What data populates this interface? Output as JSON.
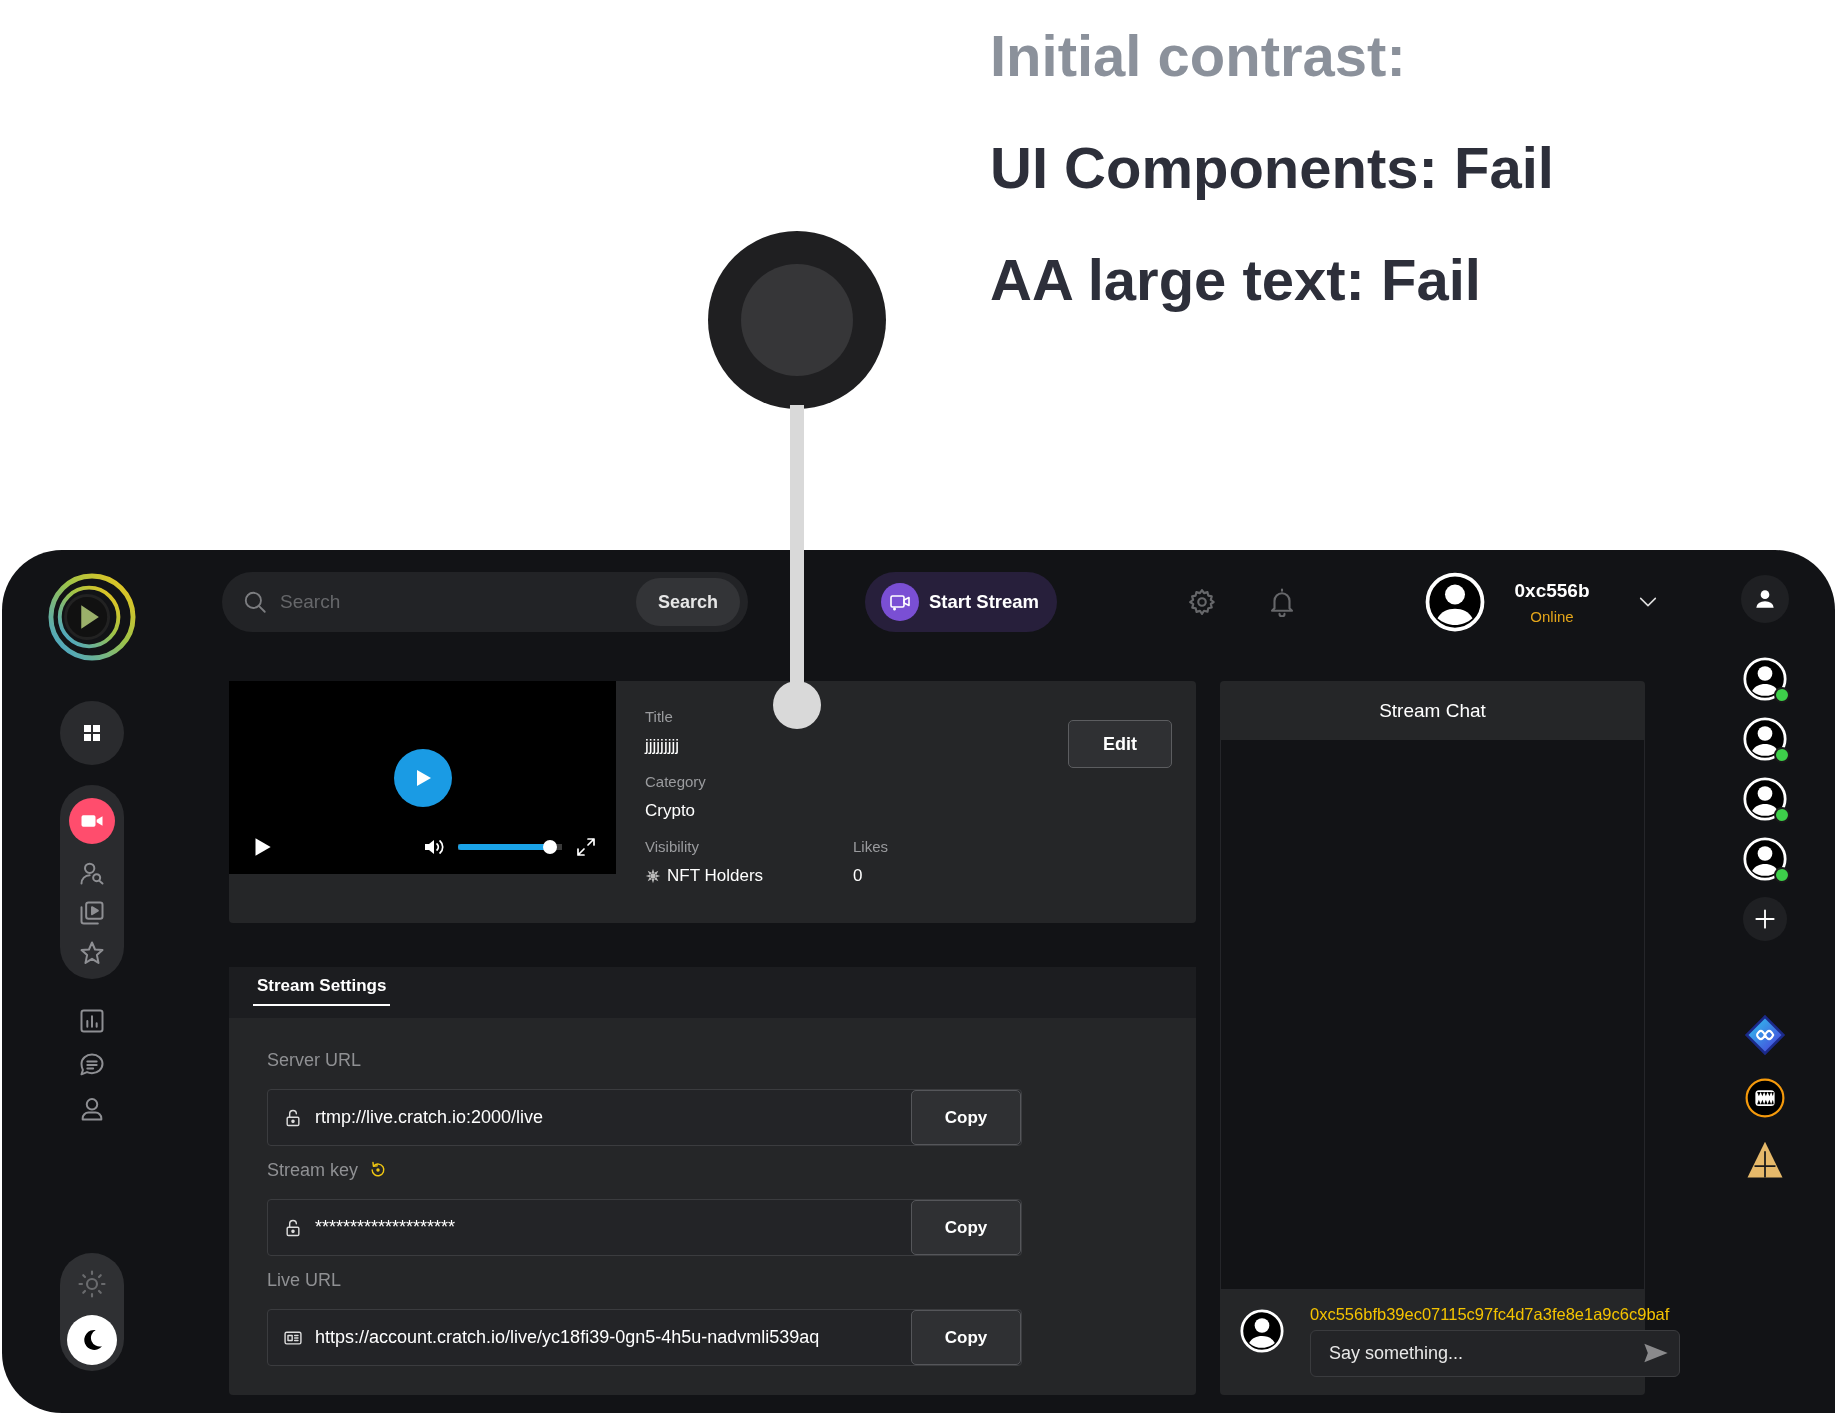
{
  "annotation": {
    "heading": "Initial contrast:",
    "results": [
      "UI Components: Fail",
      "AA large text: Fail"
    ]
  },
  "sidebar": {
    "dashboard": {
      "kind": "grid"
    },
    "group": [
      {
        "kind": "camera",
        "selected": true
      },
      {
        "kind": "people",
        "selected": false
      },
      {
        "kind": "videos",
        "selected": false
      },
      {
        "kind": "star",
        "selected": false
      }
    ],
    "items": [
      {
        "kind": "chart",
        "selected": false
      },
      {
        "kind": "chat",
        "selected": false
      },
      {
        "kind": "user",
        "selected": false
      }
    ],
    "theme": {
      "dark": true
    }
  },
  "header": {
    "search": {
      "placeholder": "Search",
      "button": "Search"
    },
    "start_stream": "Start Stream",
    "user": {
      "name": "0xc556b",
      "status": "Online"
    }
  },
  "video": {
    "volume": {
      "level": 0.94
    }
  },
  "stream_info": {
    "fields": [
      {
        "label": "Title",
        "value": "jjjjjjjjj"
      },
      {
        "label": "Category",
        "value": "Crypto"
      }
    ],
    "visibility": {
      "label": "Visibility",
      "value": "NFT Holders"
    },
    "likes": {
      "label": "Likes",
      "value": "0"
    },
    "edit": "Edit"
  },
  "settings": {
    "tabs": [
      {
        "label": "Stream Settings",
        "selected": true
      }
    ],
    "fields": [
      {
        "label": "Server URL",
        "kind": "lock",
        "value": "rtmp://live.cratch.io:2000/live",
        "refresh": false,
        "copy": "Copy"
      },
      {
        "label": "Stream key",
        "kind": "lock",
        "value": "********************",
        "refresh": true,
        "copy": "Copy"
      },
      {
        "label": "Live URL",
        "kind": "card",
        "value": "https://account.cratch.io/live/yc18fi39-0gn5-4h5u-nadvmli539aq",
        "refresh": false,
        "copy": "Copy"
      }
    ]
  },
  "chat": {
    "title": "Stream Chat",
    "sender": "0xc556bfb39ec07115c97fc4d7a3fe8e1a9c6c9baf",
    "placeholder": "Say something..."
  },
  "rail": {
    "friends": [
      {
        "online": true
      },
      {
        "online": true
      },
      {
        "online": true
      },
      {
        "online": true
      }
    ]
  }
}
